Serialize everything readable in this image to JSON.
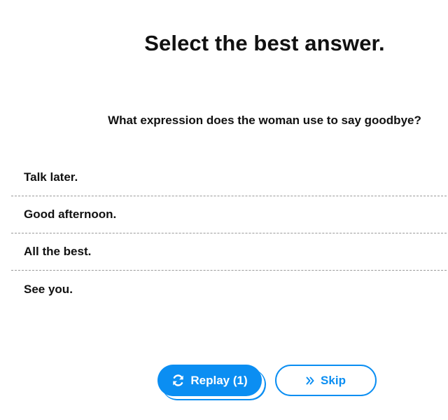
{
  "title": "Select the best answer.",
  "question": "What expression does the woman use to say goodbye?",
  "options": [
    "Talk later.",
    "Good afternoon.",
    "All the best.",
    "See you."
  ],
  "buttons": {
    "replay_label": "Replay (1)",
    "replay_icon": "refresh-icon",
    "skip_label": "Skip",
    "skip_icon": "double-chevron-right-icon"
  },
  "colors": {
    "accent": "#0b8ef2",
    "text": "#111111",
    "divider": "#9a9a9a",
    "background": "#ffffff"
  }
}
